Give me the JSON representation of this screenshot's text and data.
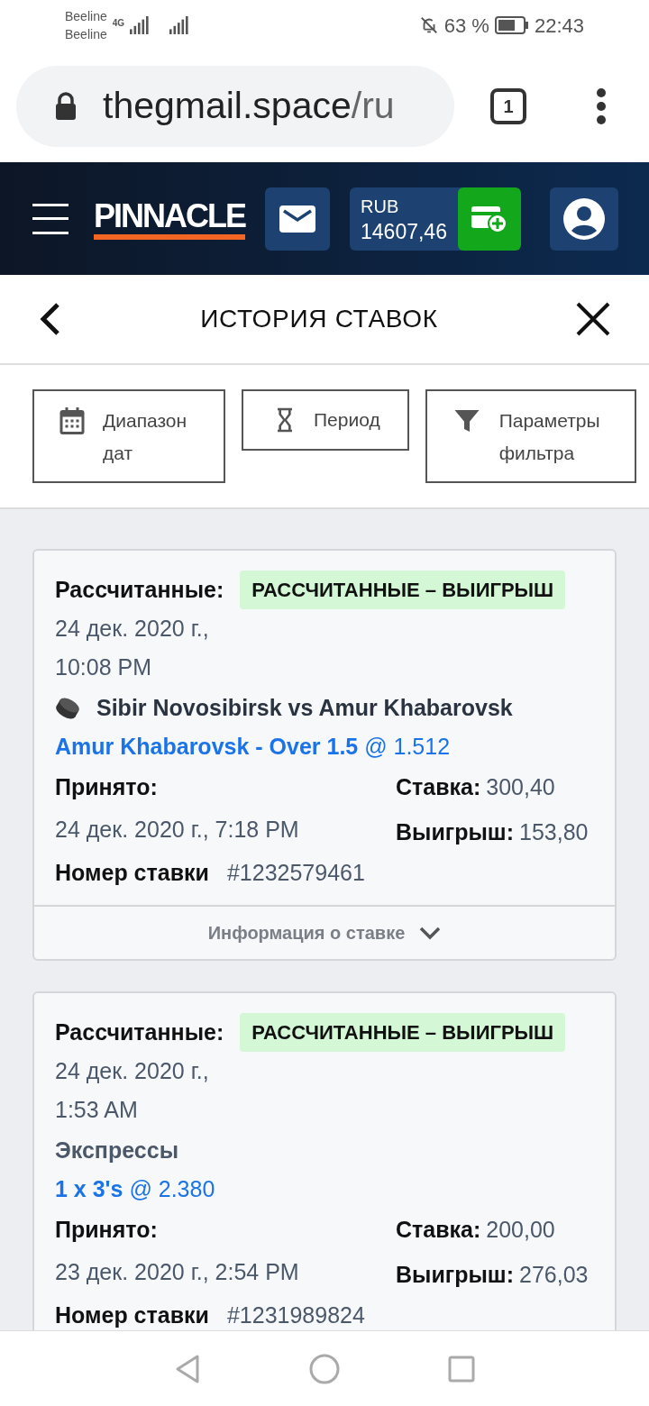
{
  "status_bar": {
    "carrier_1": "Beeline",
    "carrier_2": "Beeline",
    "network": "4G",
    "battery": "63 %",
    "time": "22:43"
  },
  "browser": {
    "url_host": "thegmail.space",
    "url_path": "/ru",
    "tab_count": "1"
  },
  "header": {
    "logo": "PINNACLE",
    "currency": "RUB",
    "balance": "14607,46"
  },
  "page": {
    "title": "ИСТОРИЯ СТАВОК"
  },
  "filters": [
    {
      "label": "Диапазон дат"
    },
    {
      "label": "Период"
    },
    {
      "label": "Параметры фильтра"
    }
  ],
  "bets": [
    {
      "kind": "single",
      "status_label": "Рассчитанные:",
      "status": "РАССЧИТАННЫЕ – ВЫИГРЫШ",
      "settled_date": "24 дек. 2020 г.,",
      "settled_time": "10:08 PM",
      "event": "Sibir Novosibirsk vs Amur Khabarovsk",
      "selection": "**Amur Khabarovsk - Over 1.5** @ 1.512",
      "accepted_label": "Принято:",
      "accepted": "24 дек. 2020 г., 7:18 PM",
      "stake_label": "Ставка:",
      "stake": "300,40",
      "win_label": "Выигрыш:",
      "win": "153,80",
      "number_label": "Номер ставки",
      "number": "#1232579461",
      "details": "Информация о ставке"
    },
    {
      "kind": "parlay",
      "status_label": "Рассчитанные:",
      "status": "РАССЧИТАННЫЕ – ВЫИГРЫШ",
      "settled_date": "24 дек. 2020 г.,",
      "settled_time": "1:53 AM",
      "event": "Экспрессы",
      "selection": "**1 x 3's** @ 2.380",
      "accepted_label": "Принято:",
      "accepted": "23 дек. 2020 г., 2:54 PM",
      "stake_label": "Ставка:",
      "stake": "200,00",
      "win_label": "Выигрыш:",
      "win": "276,03",
      "number_label": "Номер ставки",
      "number": "#1231989824"
    }
  ]
}
